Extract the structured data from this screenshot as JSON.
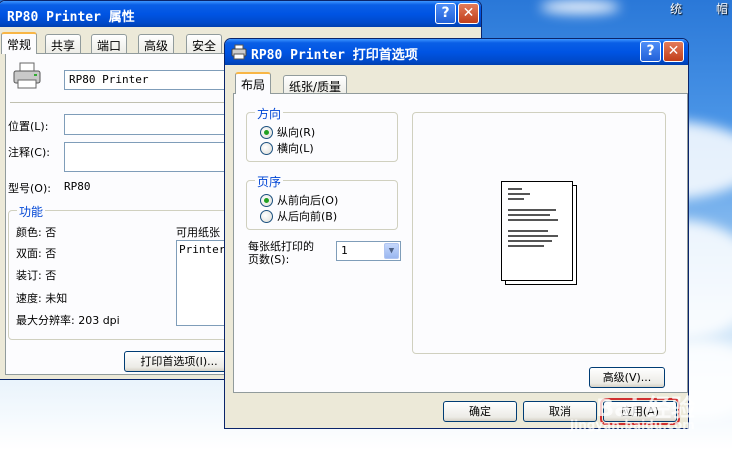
{
  "desktop": {
    "tray_text_1": "统",
    "tray_text_2": "帽",
    "watermark": "Bai 经验",
    "watermark_url": "jingyan.baidu.com"
  },
  "props_window": {
    "title": "RP80 Printer 属性",
    "tabs": [
      "常规",
      "共享",
      "端口",
      "高级",
      "安全"
    ],
    "printer_name": "RP80 Printer",
    "location_label": "位置(L):",
    "comment_label": "注释(C):",
    "model_label": "型号(O):",
    "model_value": "RP80",
    "features_title": "功能",
    "color": "颜色: 否",
    "duplex": "双面: 否",
    "staple": "装订: 否",
    "speed": "速度: 未知",
    "max_resolution": "最大分辨率: 203 dpi",
    "available_paper_label": "可用纸张",
    "paper_list_item": "Printer",
    "preferences_button": "打印首选项(I)..."
  },
  "prefs_window": {
    "title": "RP80 Printer 打印首选项",
    "tabs": [
      "布局",
      "纸张/质量"
    ],
    "orientation": {
      "title": "方向",
      "portrait": "纵向(R)",
      "landscape": "横向(L)",
      "selected": "portrait"
    },
    "page_order": {
      "title": "页序",
      "front_to_back": "从前向后(O)",
      "back_to_front": "从后向前(B)",
      "selected": "front_to_back"
    },
    "pages_per_sheet_label_1": "每张纸打印的",
    "pages_per_sheet_label_2": "页数(S):",
    "pages_per_sheet_value": "1",
    "advanced_button": "高级(V)...",
    "ok_button": "确定",
    "cancel_button": "取消",
    "apply_button": "应用(A)"
  }
}
